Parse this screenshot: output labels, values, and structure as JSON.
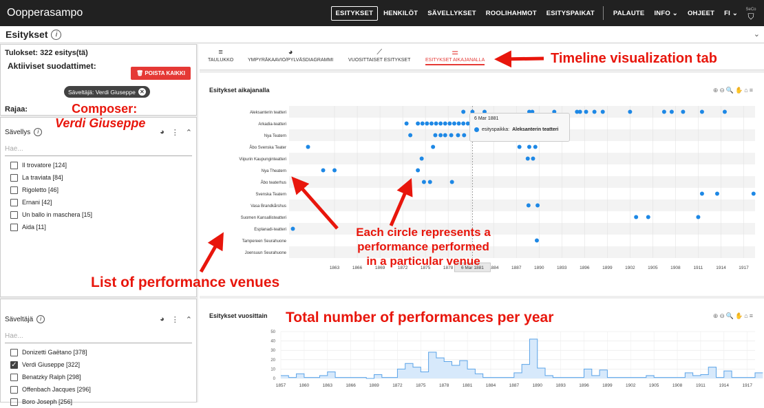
{
  "app": {
    "title": "Oopperasampo",
    "nav": [
      "ESITYKSET",
      "HENKILÖT",
      "SÄVELLYKSET",
      "ROOLIHAHMOT",
      "ESITYSPAIKAT"
    ],
    "nav_active": "ESITYKSET",
    "nav_right": [
      "PALAUTE",
      "INFO ⌄",
      "OHJEET",
      "FI ⌄"
    ],
    "logo": "SeCo"
  },
  "subheader": {
    "title": "Esitykset",
    "collapse": "⌄"
  },
  "left": {
    "results": "Tulokset: 322 esitys(tä)",
    "active_filters": "Aktiiviset suodattimet:",
    "delete_all": "POISTA KAIKKI",
    "chip": "Säveltäjä: Verdi Giuseppe",
    "rajaa": "Rajaa:",
    "facet1": {
      "title": "Sävellys",
      "search_placeholder": "Hae...",
      "items": [
        "Il trovatore [124]",
        "La traviata [84]",
        "Rigoletto [46]",
        "Ernani [42]",
        "Un ballo in maschera [15]",
        "Aida [11]"
      ]
    },
    "facet2": {
      "title": "Säveltäjä",
      "search_placeholder": "Hae...",
      "items": [
        "Donizetti Gaëtano [378]",
        "Verdi Giuseppe [322]",
        "Benatzky Ralph [298]",
        "Offenbach Jacques [296]",
        "Boro Joseph [256]"
      ],
      "checked": [
        false,
        true,
        false,
        false,
        false
      ]
    }
  },
  "tabs": [
    {
      "label": "TAULUKKO",
      "icon": "≡"
    },
    {
      "label": "YMPYRÄKAAVIO/PYLVÄSDIAGRAMMI",
      "icon": "◕"
    },
    {
      "label": "VUOSITTAISET ESITYKSET",
      "icon": "⟋"
    },
    {
      "label": "ESITYKSET AIKAJANALLA",
      "icon": "⚌"
    }
  ],
  "timeline": {
    "title": "Esitykset aikajanalla",
    "tools": "⊕⊖🔍✋⌂≡",
    "tooltip_date": "6 Mar 1881",
    "tooltip_label": "esityspaikka:",
    "tooltip_value": "Aleksanterin teatteri",
    "crosshair_label": "6 Mar 1881"
  },
  "yearly": {
    "title": "Esitykset vuosittain",
    "tools": "⊕⊖🔍✋⌂≡"
  },
  "annotations": {
    "tab": "Timeline visualization tab",
    "composer1": "Composer:",
    "composer2": "Verdi Giuseppe",
    "circles1": "Each circle represents a",
    "circles2": "performance performed",
    "circles3": "in a particular venue",
    "venues": "List of performance venues",
    "total": "Total number of performances per year"
  },
  "chart_data": [
    {
      "type": "scatter",
      "title": "Esitykset aikajanalla",
      "categories": [
        "Aleksanterin teatteri",
        "Arkadia-teatteri",
        "Nya Teatern",
        "Åbo Svenska Teater",
        "Viipurin Kaupunginteatteri",
        "Nya Theatern",
        "Åbo teaterhus",
        "Svenska Teatern",
        "Vasa Brandkårshus",
        "Suomen Kansallisteatteri",
        "Esplanadi-teatteri",
        "Tampereen Seurahuone",
        "Joensuun Seurahuone"
      ],
      "x_ticks": [
        "1863",
        "1866",
        "1869",
        "1872",
        "1875",
        "1878",
        "1881",
        "1884",
        "1887",
        "1890",
        "1893",
        "1896",
        "1899",
        "1902",
        "1905",
        "1908",
        "1911",
        "1914",
        "1917"
      ],
      "xlim": [
        1857,
        1918.5
      ],
      "points": [
        {
          "venue": "Aleksanterin teatteri",
          "years": [
            1880.0,
            1881.2,
            1882.8,
            1888.7,
            1889.1,
            1892.0,
            1895.0,
            1895.4,
            1896.2,
            1897.3,
            1898.4,
            1902.0,
            1906.5,
            1907.5,
            1909.0,
            1911.5,
            1914.5
          ]
        },
        {
          "venue": "Arkadia-teatteri",
          "years": [
            1872.5,
            1874.0,
            1874.6,
            1875.2,
            1875.8,
            1876.4,
            1877.0,
            1877.6,
            1878.2,
            1878.8,
            1879.4,
            1880.0,
            1880.6,
            1886.5
          ]
        },
        {
          "venue": "Nya Teatern",
          "years": [
            1873.0,
            1876.3,
            1877.0,
            1877.6,
            1878.4,
            1879.3,
            1880.1
          ]
        },
        {
          "venue": "Åbo Svenska Teater",
          "years": [
            1859.5,
            1876.0,
            1887.4,
            1888.7,
            1889.5
          ]
        },
        {
          "venue": "Viipurin Kaupunginteatteri",
          "years": [
            1874.5,
            1888.5,
            1889.2
          ]
        },
        {
          "venue": "Nya Theatern",
          "years": [
            1861.5,
            1863.0,
            1874.0
          ]
        },
        {
          "venue": "Åbo teaterhus",
          "years": [
            1874.8,
            1875.6,
            1878.5
          ]
        },
        {
          "venue": "Svenska Teatern",
          "years": [
            1911.5,
            1913.5,
            1918.3
          ]
        },
        {
          "venue": "Vasa Brandkårshus",
          "years": [
            1888.6,
            1889.8
          ]
        },
        {
          "venue": "Suomen Kansallisteatteri",
          "years": [
            1902.8,
            1904.4,
            1911.0
          ]
        },
        {
          "venue": "Esplanadi-teatteri",
          "years": [
            1857.5
          ]
        },
        {
          "venue": "Tampereen Seurahuone",
          "years": [
            1889.7
          ]
        },
        {
          "venue": "Joensuun Seurahuone",
          "years": []
        }
      ]
    },
    {
      "type": "area",
      "title": "Esitykset vuosittain",
      "ylim": [
        0,
        50
      ],
      "y_ticks": [
        "0",
        "10",
        "20",
        "30",
        "40",
        "50"
      ],
      "x_ticks": [
        "1857",
        "1860",
        "1863",
        "1866",
        "1869",
        "1872",
        "1875",
        "1878",
        "1881",
        "1884",
        "1887",
        "1890",
        "1893",
        "1896",
        "1899",
        "1902",
        "1905",
        "1908",
        "1911",
        "1914",
        "1917"
      ],
      "x": [
        1857,
        1858,
        1859,
        1860,
        1861,
        1862,
        1863,
        1864,
        1865,
        1866,
        1867,
        1868,
        1869,
        1870,
        1871,
        1872,
        1873,
        1874,
        1875,
        1876,
        1877,
        1878,
        1879,
        1880,
        1881,
        1882,
        1883,
        1884,
        1885,
        1886,
        1887,
        1888,
        1889,
        1890,
        1891,
        1892,
        1893,
        1894,
        1895,
        1896,
        1897,
        1898,
        1899,
        1900,
        1901,
        1902,
        1903,
        1904,
        1905,
        1906,
        1907,
        1908,
        1909,
        1910,
        1911,
        1912,
        1913,
        1914,
        1915,
        1916,
        1917,
        1918
      ],
      "values": [
        3,
        1,
        5,
        1,
        1,
        3,
        7,
        1,
        1,
        1,
        1,
        0,
        4,
        1,
        1,
        10,
        16,
        12,
        7,
        28,
        22,
        18,
        14,
        19,
        10,
        5,
        1,
        1,
        1,
        1,
        6,
        15,
        42,
        11,
        3,
        1,
        1,
        1,
        1,
        10,
        3,
        9,
        1,
        1,
        1,
        1,
        1,
        3,
        1,
        1,
        1,
        1,
        6,
        3,
        4,
        12,
        1,
        8,
        1,
        1,
        1,
        6
      ]
    }
  ]
}
